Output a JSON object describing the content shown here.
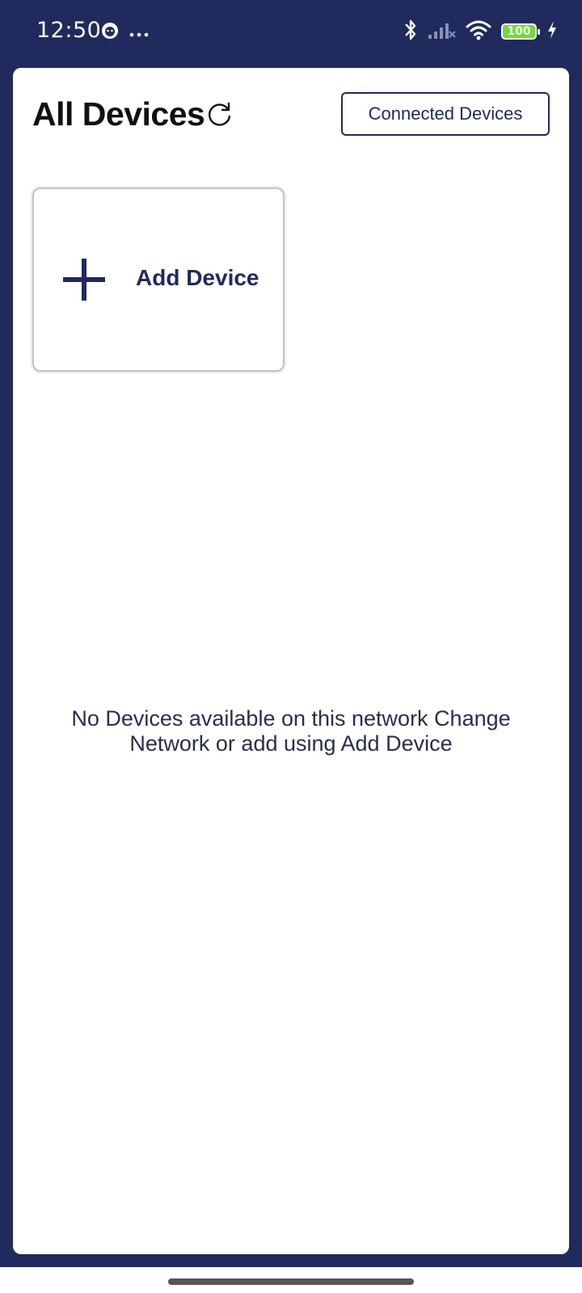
{
  "status_bar": {
    "time": "12:50",
    "battery_level": "100",
    "icons": [
      "app-notification-icon",
      "more-dots-icon",
      "bluetooth-icon",
      "signal-icon",
      "wifi-icon",
      "battery-icon",
      "charging-icon"
    ]
  },
  "header": {
    "title": "All Devices",
    "refresh_icon": "refresh-icon",
    "connected_devices_label": "Connected Devices"
  },
  "add_device": {
    "label": "Add Device",
    "icon": "plus-icon"
  },
  "empty_state": {
    "message": "No Devices available on this network Change Network or add using Add Device"
  },
  "colors": {
    "brand_navy": "#212a5c",
    "battery_green": "#6fdc3a",
    "card_bg": "#ffffff"
  }
}
